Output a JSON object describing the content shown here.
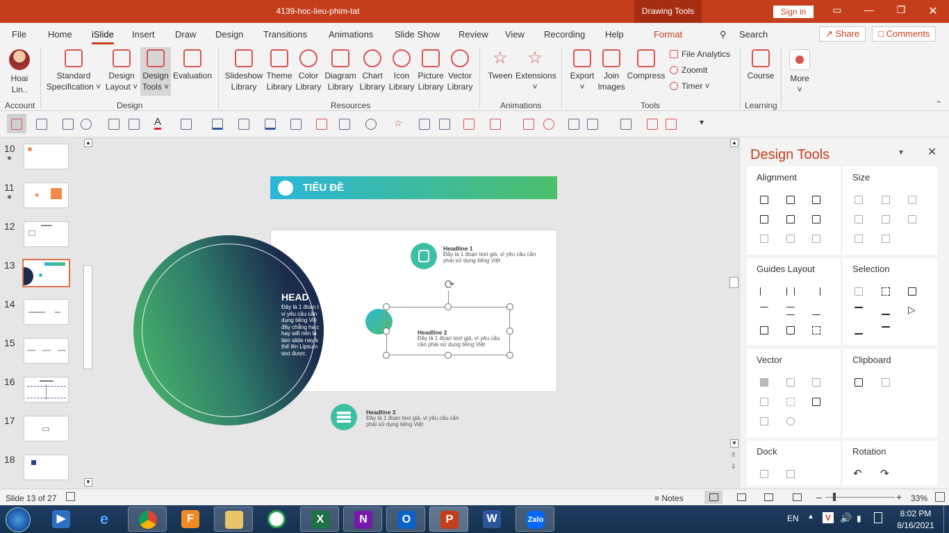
{
  "window": {
    "title": "4139-hoc-lieu-phim-tat",
    "context_tab": "Drawing Tools",
    "sign_in": "Sign in"
  },
  "tabs": [
    "File",
    "Home",
    "iSlide",
    "Insert",
    "Draw",
    "Design",
    "Transitions",
    "Animations",
    "Slide Show",
    "Review",
    "View",
    "Recording",
    "Help",
    "Format"
  ],
  "active_tab": "iSlide",
  "search_label": "Search",
  "share_label": "Share",
  "comments_label": "Comments",
  "ribbon": {
    "account": {
      "name": "Hoai",
      "name2": "Lin..",
      "group": "Account"
    },
    "design": {
      "group": "Design",
      "buttons": [
        {
          "l1": "Standard",
          "l2": "Specification ˅"
        },
        {
          "l1": "Design",
          "l2": "Layout ˅"
        },
        {
          "l1": "Design",
          "l2": "Tools ˅"
        },
        {
          "l1": "Evaluation",
          "l2": ""
        }
      ]
    },
    "resources": {
      "group": "Resources",
      "buttons": [
        {
          "l1": "Slideshow",
          "l2": "Library"
        },
        {
          "l1": "Theme",
          "l2": "Library"
        },
        {
          "l1": "Color",
          "l2": "Library"
        },
        {
          "l1": "Diagram",
          "l2": "Library"
        },
        {
          "l1": "Chart",
          "l2": "Library"
        },
        {
          "l1": "Icon",
          "l2": "Library"
        },
        {
          "l1": "Picture",
          "l2": "Library"
        },
        {
          "l1": "Vector",
          "l2": "Library"
        }
      ]
    },
    "animations": {
      "group": "Animations",
      "buttons": [
        {
          "l1": "Tween",
          "l2": ""
        },
        {
          "l1": "Extensions",
          "l2": "˅"
        }
      ]
    },
    "tools": {
      "group": "Tools",
      "buttons": [
        {
          "l1": "Export",
          "l2": "˅"
        },
        {
          "l1": "Join",
          "l2": "Images"
        },
        {
          "l1": "Compress",
          "l2": ""
        }
      ],
      "small": [
        "File Analytics",
        "ZoomIt",
        "Timer ˅"
      ]
    },
    "learning": {
      "group": "Learning",
      "buttons": [
        {
          "l1": "Course",
          "l2": ""
        }
      ]
    },
    "more": {
      "l1": "More",
      "l2": "˅"
    }
  },
  "thumbnails": [
    {
      "num": "10",
      "star": "★"
    },
    {
      "num": "11",
      "star": "★"
    },
    {
      "num": "12",
      "star": ""
    },
    {
      "num": "13",
      "star": ""
    },
    {
      "num": "14",
      "star": ""
    },
    {
      "num": "15",
      "star": ""
    },
    {
      "num": "16",
      "star": ""
    },
    {
      "num": "17",
      "star": ""
    },
    {
      "num": "18",
      "star": ""
    }
  ],
  "slide": {
    "title": "TIÊU ĐỀ",
    "circle_heading": "HEAD",
    "circle_text": "Đây là 1 đoạn t vi yêu cầu cần dụng tiếng Việ đây chẳng hạ c hay wifi nên là làm slide này k thể lên Lipsum text được.",
    "items": [
      {
        "head": "Headline 1",
        "text": "Đây là 1 đoạn text giả, vì yêu cầu cần phải sử dụng tiếng Việt"
      },
      {
        "head": "Headline 2",
        "text": "Đây là 1 đoạn text giả, vì yêu cầu cần phải sử dụng tiếng Việt"
      },
      {
        "head": "Headline 3",
        "text": "Đây là 1 đoạn text giả, vì yêu cầu cần phải sử dụng tiếng Việt"
      }
    ]
  },
  "pane": {
    "title": "Design Tools",
    "sections": [
      "Alignment",
      "Size",
      "Guides Layout",
      "Selection",
      "Vector",
      "Clipboard",
      "Dock",
      "Rotation"
    ]
  },
  "status": {
    "slide_info": "Slide 13 of 27",
    "notes": "Notes",
    "zoom": "33%"
  },
  "taskbar": {
    "lang": "EN",
    "time": "8:02 PM",
    "date": "8/16/2021",
    "apps": [
      "windows-media",
      "internet-explorer",
      "chrome",
      "foxit-pdf",
      "file-explorer",
      "coccoc",
      "excel",
      "onenote",
      "outlook",
      "powerpoint",
      "word",
      "zalo"
    ],
    "app_labels": {
      "excel": "X",
      "onenote": "N",
      "outlook": "O",
      "powerpoint": "P",
      "word": "W",
      "zalo": "Zalo"
    }
  },
  "colors": {
    "accent": "#c43e1c",
    "title_grad_start": "#2bb7d9",
    "title_grad_end": "#4dbf6a",
    "circle_dark": "#1b2b4d",
    "circle_green": "#4dbf6a"
  }
}
